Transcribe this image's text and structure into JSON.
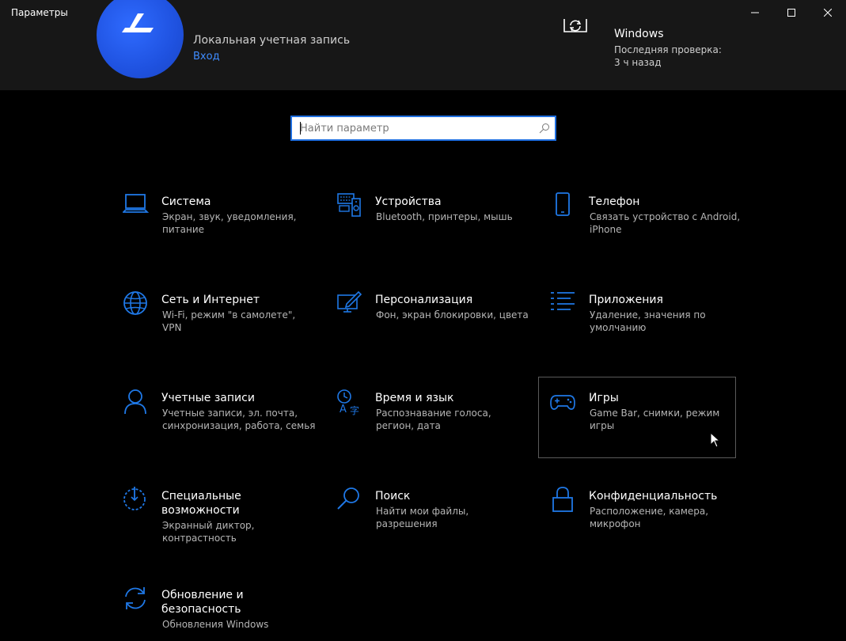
{
  "window": {
    "title": "Параметры"
  },
  "account": {
    "name": "Локальная учетная запись",
    "signin": "Вход"
  },
  "update": {
    "title": "Windows",
    "line1": "Последняя проверка:",
    "line2": "3 ч назад"
  },
  "search": {
    "placeholder": "Найти параметр",
    "value": ""
  },
  "tiles": [
    {
      "title": "Система",
      "desc": "Экран, звук, уведомления, питание",
      "icon": "laptop-icon"
    },
    {
      "title": "Устройства",
      "desc": "Bluetooth, принтеры, мышь",
      "icon": "devices-icon"
    },
    {
      "title": "Телефон",
      "desc": "Связать устройство с Android, iPhone",
      "icon": "phone-icon"
    },
    {
      "title": "Сеть и Интернет",
      "desc": "Wi-Fi, режим \"в самолете\", VPN",
      "icon": "globe-icon"
    },
    {
      "title": "Персонализация",
      "desc": "Фон, экран блокировки, цвета",
      "icon": "personalization-icon"
    },
    {
      "title": "Приложения",
      "desc": "Удаление, значения по умолчанию",
      "icon": "apps-list-icon"
    },
    {
      "title": "Учетные записи",
      "desc": "Учетные записи, эл. почта, синхронизация, работа, семья",
      "icon": "user-icon"
    },
    {
      "title": "Время и язык",
      "desc": "Распознавание голоса, регион, дата",
      "icon": "time-language-icon"
    },
    {
      "title": "Игры",
      "desc": "Game Bar, снимки, режим игры",
      "icon": "gamepad-icon"
    },
    {
      "title": "Специальные возможности",
      "desc": "Экранный диктор, контрастность",
      "icon": "ease-of-access-icon"
    },
    {
      "title": "Поиск",
      "desc": "Найти мои файлы, разрешения",
      "icon": "search-magnifier-icon"
    },
    {
      "title": "Конфиденциальность",
      "desc": "Расположение, камера, микрофон",
      "icon": "lock-icon"
    },
    {
      "title": "Обновление и безопасность",
      "desc": "Обновления Windows",
      "icon": "update-sync-icon"
    }
  ],
  "colors": {
    "accent": "#1f78e6",
    "background": "#000000",
    "header": "#171717",
    "link": "#3f8cff"
  }
}
